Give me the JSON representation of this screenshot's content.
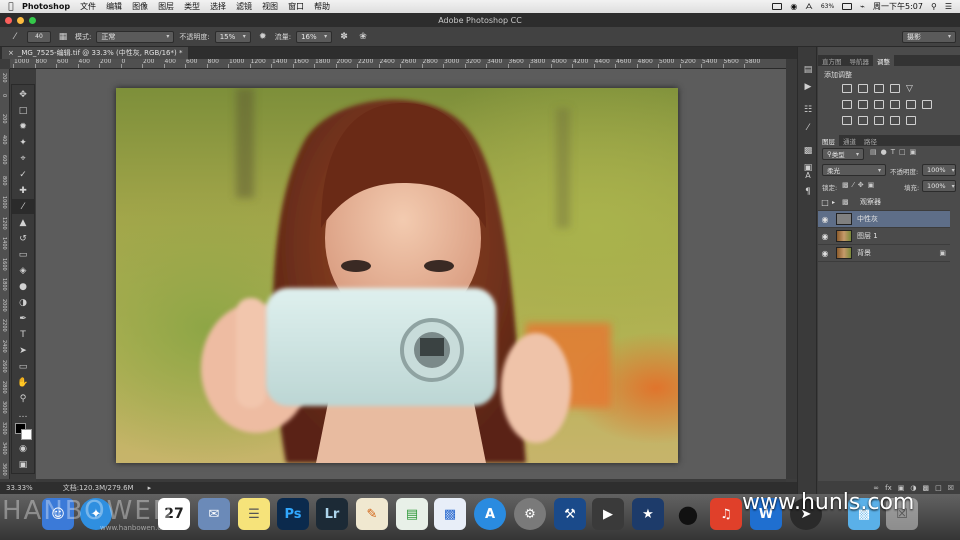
{
  "menubar": {
    "app_name": "Photoshop",
    "items": [
      "文件",
      "编辑",
      "图像",
      "图层",
      "类型",
      "选择",
      "滤镜",
      "视图",
      "窗口",
      "帮助"
    ],
    "battery_pct": "63%",
    "clock": "周一下午5:07"
  },
  "window": {
    "title": "Adobe Photoshop CC"
  },
  "options": {
    "brush_size": "40",
    "mode_label": "模式:",
    "mode_value": "正常",
    "opacity_label": "不透明度:",
    "opacity_value": "15%",
    "flow_label": "流量:",
    "flow_value": "16%",
    "workspace": "摄影"
  },
  "document": {
    "tab_title": "_MG_7525-编辑.tif @ 33.3% (中性灰, RGB/16*) *",
    "zoom": "33.33%",
    "doc_info": "文档:120.3M/279.6M"
  },
  "ruler_h_labels": [
    "1000",
    "800",
    "600",
    "400",
    "200",
    "0",
    "200",
    "400",
    "600",
    "800",
    "1000",
    "1200",
    "1400",
    "1600",
    "1800",
    "2000",
    "2200",
    "2400",
    "2600",
    "2800",
    "3000",
    "3200",
    "3400",
    "3600",
    "3800",
    "4000",
    "4200",
    "4400",
    "4600",
    "4800",
    "5000",
    "5200",
    "5400",
    "5600",
    "5800"
  ],
  "ruler_v_labels": [
    "200",
    "0",
    "200",
    "400",
    "600",
    "800",
    "1000",
    "1200",
    "1400",
    "1600",
    "1800",
    "2000",
    "2200",
    "2400",
    "2600",
    "2800",
    "3000",
    "3200",
    "3400",
    "3600"
  ],
  "panels": {
    "top_tabs": [
      "直方图",
      "导航器",
      "调整"
    ],
    "adjust_title": "添加调整",
    "layer_tabs": [
      "图层",
      "通道",
      "路径"
    ],
    "filter_kind": "类型",
    "blend_mode": "柔光",
    "opacity_label": "不透明度:",
    "opacity_value": "100%",
    "lock_label": "锁定:",
    "fill_label": "填充:",
    "fill_value": "100%",
    "layers": [
      {
        "name": "观察器",
        "type": "group"
      },
      {
        "name": "中性灰",
        "type": "gray"
      },
      {
        "name": "图层 1",
        "type": "photo"
      },
      {
        "name": "背景",
        "type": "photo"
      }
    ]
  },
  "watermark": {
    "left": "HANBOWEN",
    "left_sub": "www.hanbowen.com",
    "right": "www.hunls.com"
  },
  "dock": {
    "calendar_day": "27",
    "ps_label": "Ps",
    "lr_label": "Lr"
  },
  "colors": {
    "ps_blue": "#0b2a4d",
    "lr_dark": "#1c2a36",
    "selected_layer": "#5e6e88"
  }
}
